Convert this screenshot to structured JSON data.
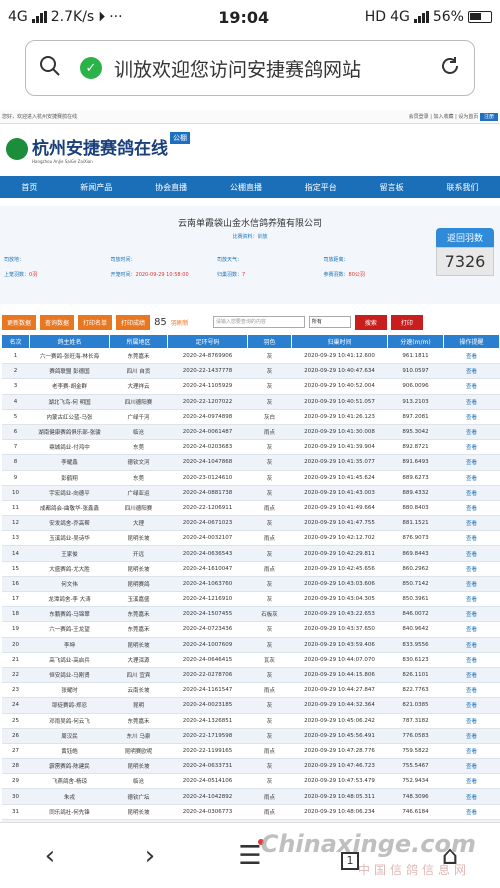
{
  "status": {
    "network": "4G",
    "speed": "2.7K/s",
    "time": "19:04",
    "hd": "HD",
    "net2": "4G",
    "battery": "56%"
  },
  "browser": {
    "url_title": "训放欢迎您访问安捷赛鸽网站"
  },
  "site": {
    "top_left": "您好，欢迎进入杭州安捷赛鸽在线",
    "top_right": "会员登录 | 加入收藏 | 设为首页",
    "top_register": "注册",
    "logo_title": "杭州安捷赛鸽在线",
    "logo_sub": "Hangzhou AnJie SaiGe ZaiXian",
    "logo_tag": "公棚",
    "nav": [
      "首页",
      "新闻产品",
      "协会直播",
      "公棚直播",
      "指定平台",
      "留言板",
      "联系我们"
    ],
    "club_name": "云南单霞袋山金水信鸽养殖有限公司",
    "club_sub": "比赛资料：训放",
    "info": [
      {
        "label": "司放地：",
        "value": ""
      },
      {
        "label": "司放时间：",
        "value": ""
      },
      {
        "label": "司放天气：",
        "value": ""
      },
      {
        "label": "司放距离：",
        "value": ""
      },
      {
        "label": "上笼羽数：",
        "value": "0羽"
      },
      {
        "label": "开笼时间：",
        "value": "2020-09-29 10:58:00"
      },
      {
        "label": "归巢羽数：",
        "value": "7"
      },
      {
        "label": "参赛羽数：",
        "value": "80公羽"
      }
    ],
    "badge_label": "返回羽数",
    "badge_value": "7326",
    "toolbar": {
      "btn1": "更新数据",
      "btn2": "查询数据",
      "btn3": "打印名单",
      "btn4": "打印成绩",
      "count": "85",
      "count_unit": "羽刷新",
      "search_placeholder": "请输入您要查询的内容",
      "select_value": "所有",
      "search_btn": "搜索",
      "print_btn": "打印"
    },
    "columns": [
      "名次",
      "鸽主姓名",
      "所属地区",
      "足环号码",
      "羽色",
      "归巢时间",
      "分速(m/m)",
      "操作提醒"
    ],
    "rows": [
      [
        "1",
        "六一赛鸽-张旺海-林长海",
        "东莞嘉禾",
        "2020-24-8769906",
        "灰",
        "2020-09-29 10:41:12.600",
        "961.1811",
        "查看"
      ],
      [
        "2",
        "赛鸽联盟 彭德国",
        "四川 自贡",
        "2020-22-1437778",
        "灰",
        "2020-09-29 10:40:47.634",
        "910.0597",
        "查看"
      ],
      [
        "3",
        "老李赛-胡金群",
        "大理祥云",
        "2020-24-1105929",
        "灰",
        "2020-09-29 10:40:52.004",
        "906.0096",
        "查看"
      ],
      [
        "4",
        "湖北飞鸟-何 明国",
        "四川德阳赛",
        "2020-22-1207022",
        "灰",
        "2020-09-29 10:40:51.057",
        "913.2103",
        "查看"
      ],
      [
        "5",
        "内蒙古红公蓝-马张",
        "广绿千河",
        "2020-24-0974898",
        "灰白",
        "2020-09-29 10:41:26.123",
        "897.2081",
        "查看"
      ],
      [
        "6",
        "湖南健康赛鸽俱乐部-张骏",
        "临沧",
        "2020-24-0061487",
        "雨点",
        "2020-09-29 10:41:30.008",
        "895.3042",
        "查看"
      ],
      [
        "7",
        "鼎城鸽业-付鸿中",
        "东莞",
        "2020-24-0203683",
        "灰",
        "2020-09-29 10:41:39.904",
        "892.8721",
        "查看"
      ],
      [
        "8",
        "李耀鑫",
        "德钦文河",
        "2020-24-1047868",
        "灰",
        "2020-09-29 10:41:35.077",
        "891.6493",
        "查看"
      ],
      [
        "9",
        "彭鹤翔",
        "东莞",
        "2020-23-0124610",
        "灰",
        "2020-09-29 10:41:45.624",
        "889.6273",
        "查看"
      ],
      [
        "10",
        "宇宏鸽业-向德平",
        "广绿亚运",
        "2020-24-0881738",
        "灰",
        "2020-09-29 10:41:43.003",
        "889.4332",
        "查看"
      ],
      [
        "11",
        "成都鸽会-曲敬华-张鑫鑫",
        "四川德阳赛",
        "2020-22-1206911",
        "雨点",
        "2020-09-29 10:41:49.664",
        "880.8403",
        "查看"
      ],
      [
        "12",
        "安发鸽舍-乔高帮",
        "大理",
        "2020-24-0671023",
        "灰",
        "2020-09-29 10:41:47.755",
        "881.1521",
        "查看"
      ],
      [
        "13",
        "玉溪鸽业-吴诗华",
        "昆明长坡",
        "2020-24-0032107",
        "雨点",
        "2020-09-29 10:42:12.702",
        "876.9073",
        "查看"
      ],
      [
        "14",
        "王家俊",
        "开远",
        "2020-24-0636543",
        "灰",
        "2020-09-29 10:42:29.811",
        "869.8443",
        "查看"
      ],
      [
        "15",
        "大盛赛鸽-尤大胜",
        "昆明长坡",
        "2020-24-1610047",
        "雨点",
        "2020-09-29 10:42:45.656",
        "860.2962",
        "查看"
      ],
      [
        "16",
        "何文伟",
        "昆明赛鸽",
        "2020-24-1063760",
        "灰",
        "2020-09-29 10:43:03.606",
        "850.7142",
        "查看"
      ],
      [
        "17",
        "龙潭鸽舍-李 大涛",
        "玉溪嘉盛",
        "2020-24-1216910",
        "灰",
        "2020-09-29 10:43:04.305",
        "850.3961",
        "查看"
      ],
      [
        "18",
        "东鹏赛鸽-马锦翠",
        "东莞嘉禾",
        "2020-24-1507455",
        "石板灰",
        "2020-09-29 10:43:22.653",
        "846.0072",
        "查看"
      ],
      [
        "19",
        "六一赛鸽-王龙望",
        "东莞嘉禾",
        "2020-24-0723436",
        "灰",
        "2020-09-29 10:43:37.650",
        "840.9642",
        "查看"
      ],
      [
        "20",
        "李坤",
        "昆明长坡",
        "2020-24-1007609",
        "灰",
        "2020-09-29 10:43:59.406",
        "833.9556",
        "查看"
      ],
      [
        "21",
        "高飞鸽业-高启兵",
        "大理洱源",
        "2020-24-0646415",
        "瓦灰",
        "2020-09-29 10:44:07.070",
        "830.6123",
        "查看"
      ],
      [
        "22",
        "恒安鸽业-马刚贤",
        "四川 宜宾",
        "2020-22-0278706",
        "灰",
        "2020-09-29 10:44:15.806",
        "826.1101",
        "查看"
      ],
      [
        "23",
        "张耀时",
        "云南长坡",
        "2020-24-1161547",
        "雨点",
        "2020-09-29 10:44:27.847",
        "822.7763",
        "查看"
      ],
      [
        "24",
        "耶徒赛鸽-郑忍",
        "昆明",
        "2020-24-0023185",
        "灰",
        "2020-09-29 10:44:32.364",
        "821.0385",
        "查看"
      ],
      [
        "25",
        "邓雨吴鸽-何云飞",
        "东莞嘉禾",
        "2020-24-1326851",
        "灰",
        "2020-09-29 10:45:06.242",
        "787.3182",
        "查看"
      ],
      [
        "26",
        "周汉民",
        "东川 马泉",
        "2020-22-1719598",
        "灰",
        "2020-09-29 10:45:56.491",
        "776.0583",
        "查看"
      ],
      [
        "27",
        "黄钰皓",
        "昆明赛欧呢",
        "2020-22-1199165",
        "雨点",
        "2020-09-29 10:47:28.776",
        "759.5822",
        "查看"
      ],
      [
        "28",
        "霹雳赛鸽-陈建民",
        "昆明长坡",
        "2020-24-0633731",
        "灰",
        "2020-09-29 10:47:46.723",
        "755.5467",
        "查看"
      ],
      [
        "29",
        "飞燕鸽舍-杨琼",
        "临沧",
        "2020-24-0514106",
        "灰",
        "2020-09-29 10:47:53.479",
        "752.9434",
        "查看"
      ],
      [
        "30",
        "朱戎",
        "德钦广坛",
        "2020-24-1042892",
        "雨点",
        "2020-09-29 10:48:05.311",
        "748.3096",
        "查看"
      ],
      [
        "31",
        "同乐鸽社-何先锋",
        "昆明长坡",
        "2020-24-0306773",
        "雨点",
        "2020-09-29 10:48:06.234",
        "746.6184",
        "查看"
      ],
      [
        "32",
        "蓝天鸽友-王德兵",
        "昆明",
        "2020-24-0076312",
        "雨点",
        "2020-09-29 10:48:12.067",
        "745.4526",
        "查看"
      ]
    ]
  },
  "icons": {
    "search": "search-icon",
    "refresh": "refresh-icon",
    "shield": "shield-check-icon"
  },
  "bottom": {
    "tab_count": "1"
  },
  "watermark": {
    "main": "Chinaxinge.com",
    "sub": "中国信鸽信息网"
  },
  "colors": {
    "nav_blue": "#1a6fb8",
    "header_blue": "#2a7fd0",
    "orange": "#e87722",
    "red": "#c81e1e"
  }
}
